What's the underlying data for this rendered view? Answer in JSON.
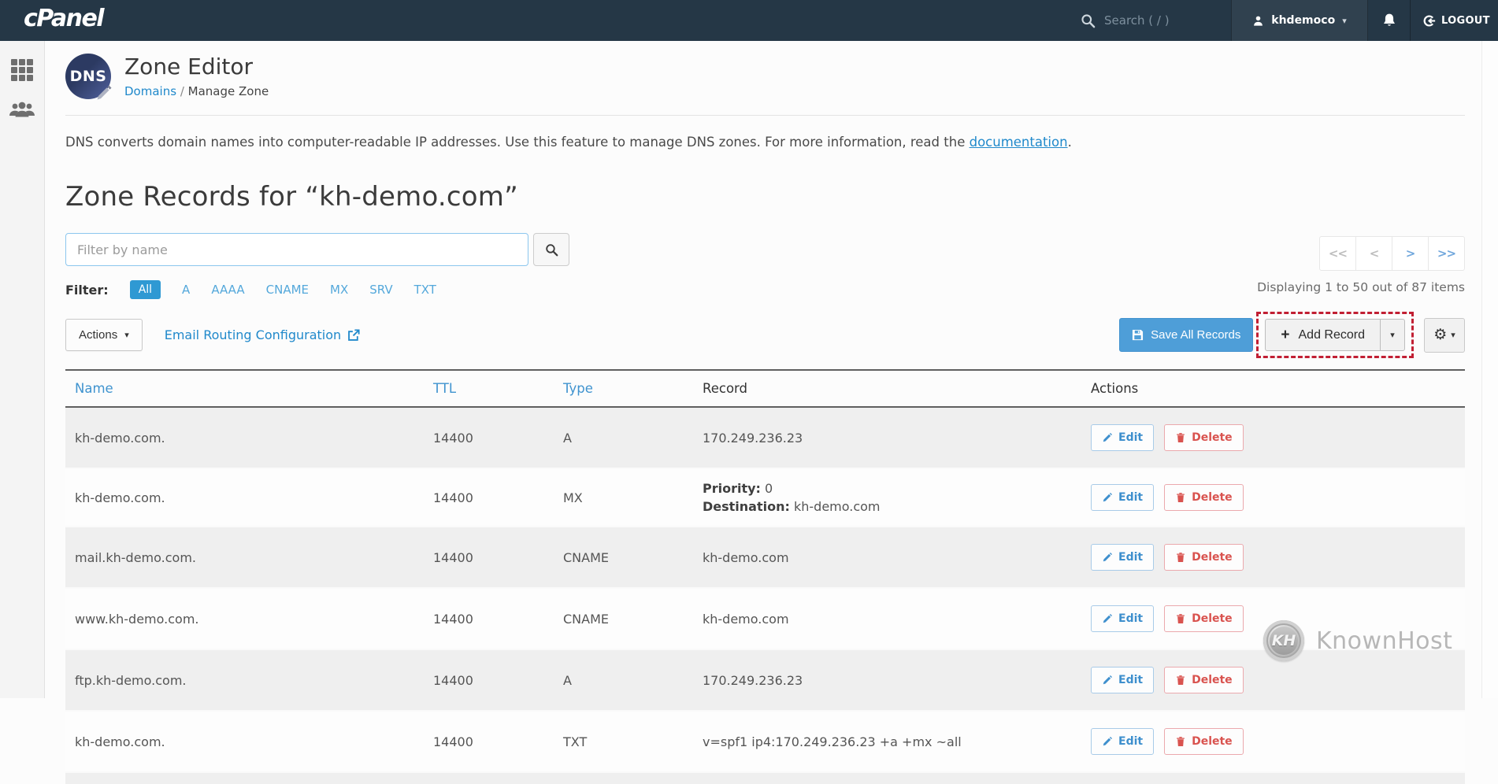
{
  "navbar": {
    "brand": "cPanel",
    "search_placeholder": "Search ( / )",
    "username": "khdemoco",
    "logout_label": "LOGOUT"
  },
  "header": {
    "badge_label": "DNS",
    "title": "Zone Editor",
    "breadcrumb_domains": "Domains",
    "breadcrumb_separator": "/",
    "breadcrumb_current": "Manage Zone"
  },
  "intro": {
    "text": "DNS converts domain names into computer-readable IP addresses. Use this feature to manage DNS zones. For more information, read the ",
    "link_label": "documentation",
    "suffix": "."
  },
  "zone_heading": "Zone Records for “kh-demo.com”",
  "filter": {
    "input_placeholder": "Filter by name",
    "label": "Filter:",
    "options": [
      {
        "label": "All",
        "active": true
      },
      {
        "label": "A",
        "active": false
      },
      {
        "label": "AAAA",
        "active": false
      },
      {
        "label": "CNAME",
        "active": false
      },
      {
        "label": "MX",
        "active": false
      },
      {
        "label": "SRV",
        "active": false
      },
      {
        "label": "TXT",
        "active": false
      }
    ]
  },
  "pagination": {
    "first_label": "<<",
    "prev_label": "<",
    "next_label": ">",
    "last_label": ">>",
    "summary": "Displaying 1 to 50 out of 87 items"
  },
  "toolbar": {
    "actions_label": "Actions",
    "email_routing_label": "Email Routing Configuration",
    "save_all_label": "Save All Records",
    "add_record_label": "Add Record"
  },
  "table": {
    "headers": {
      "name": "Name",
      "ttl": "TTL",
      "type": "Type",
      "record": "Record",
      "actions": "Actions"
    },
    "edit_label": "Edit",
    "delete_label": "Delete",
    "rows": [
      {
        "name": "kh-demo.com.",
        "ttl": "14400",
        "type": "A",
        "record": "170.249.236.23"
      },
      {
        "name": "kh-demo.com.",
        "ttl": "14400",
        "type": "MX",
        "priority_label": "Priority:",
        "priority_value": "0",
        "destination_label": "Destination:",
        "destination_value": "kh-demo.com"
      },
      {
        "name": "mail.kh-demo.com.",
        "ttl": "14400",
        "type": "CNAME",
        "record": "kh-demo.com"
      },
      {
        "name": "www.kh-demo.com.",
        "ttl": "14400",
        "type": "CNAME",
        "record": "kh-demo.com"
      },
      {
        "name": "ftp.kh-demo.com.",
        "ttl": "14400",
        "type": "A",
        "record": "170.249.236.23"
      },
      {
        "name": "kh-demo.com.",
        "ttl": "14400",
        "type": "TXT",
        "record": "v=spf1 ip4:170.249.236.23 +a +mx ~all"
      }
    ]
  },
  "icons": {
    "caret_down": "▾",
    "gear": "⚙",
    "plus": "+"
  },
  "watermark": {
    "badge": "KH",
    "text": "KnownHost"
  },
  "colors": {
    "navbar_bg": "#253746",
    "accent_blue": "#2089cb",
    "filter_active_bg": "#2f99d3",
    "save_button_blue": "#4e9ed8",
    "annotation_red": "#c11f33",
    "edit_blue": "#3e8fcd",
    "delete_red": "#d9534f",
    "row_stripe_gray": "#efefef"
  }
}
